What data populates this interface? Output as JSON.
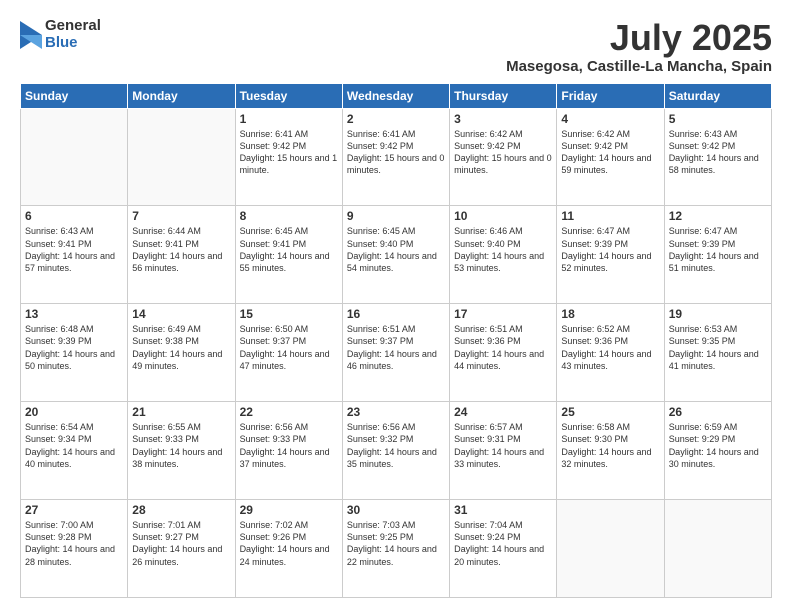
{
  "logo": {
    "general": "General",
    "blue": "Blue"
  },
  "title": "July 2025",
  "location": "Masegosa, Castille-La Mancha, Spain",
  "days_of_week": [
    "Sunday",
    "Monday",
    "Tuesday",
    "Wednesday",
    "Thursday",
    "Friday",
    "Saturday"
  ],
  "weeks": [
    [
      {
        "day": "",
        "info": ""
      },
      {
        "day": "",
        "info": ""
      },
      {
        "day": "1",
        "info": "Sunrise: 6:41 AM\nSunset: 9:42 PM\nDaylight: 15 hours and 1 minute."
      },
      {
        "day": "2",
        "info": "Sunrise: 6:41 AM\nSunset: 9:42 PM\nDaylight: 15 hours and 0 minutes."
      },
      {
        "day": "3",
        "info": "Sunrise: 6:42 AM\nSunset: 9:42 PM\nDaylight: 15 hours and 0 minutes."
      },
      {
        "day": "4",
        "info": "Sunrise: 6:42 AM\nSunset: 9:42 PM\nDaylight: 14 hours and 59 minutes."
      },
      {
        "day": "5",
        "info": "Sunrise: 6:43 AM\nSunset: 9:42 PM\nDaylight: 14 hours and 58 minutes."
      }
    ],
    [
      {
        "day": "6",
        "info": "Sunrise: 6:43 AM\nSunset: 9:41 PM\nDaylight: 14 hours and 57 minutes."
      },
      {
        "day": "7",
        "info": "Sunrise: 6:44 AM\nSunset: 9:41 PM\nDaylight: 14 hours and 56 minutes."
      },
      {
        "day": "8",
        "info": "Sunrise: 6:45 AM\nSunset: 9:41 PM\nDaylight: 14 hours and 55 minutes."
      },
      {
        "day": "9",
        "info": "Sunrise: 6:45 AM\nSunset: 9:40 PM\nDaylight: 14 hours and 54 minutes."
      },
      {
        "day": "10",
        "info": "Sunrise: 6:46 AM\nSunset: 9:40 PM\nDaylight: 14 hours and 53 minutes."
      },
      {
        "day": "11",
        "info": "Sunrise: 6:47 AM\nSunset: 9:39 PM\nDaylight: 14 hours and 52 minutes."
      },
      {
        "day": "12",
        "info": "Sunrise: 6:47 AM\nSunset: 9:39 PM\nDaylight: 14 hours and 51 minutes."
      }
    ],
    [
      {
        "day": "13",
        "info": "Sunrise: 6:48 AM\nSunset: 9:39 PM\nDaylight: 14 hours and 50 minutes."
      },
      {
        "day": "14",
        "info": "Sunrise: 6:49 AM\nSunset: 9:38 PM\nDaylight: 14 hours and 49 minutes."
      },
      {
        "day": "15",
        "info": "Sunrise: 6:50 AM\nSunset: 9:37 PM\nDaylight: 14 hours and 47 minutes."
      },
      {
        "day": "16",
        "info": "Sunrise: 6:51 AM\nSunset: 9:37 PM\nDaylight: 14 hours and 46 minutes."
      },
      {
        "day": "17",
        "info": "Sunrise: 6:51 AM\nSunset: 9:36 PM\nDaylight: 14 hours and 44 minutes."
      },
      {
        "day": "18",
        "info": "Sunrise: 6:52 AM\nSunset: 9:36 PM\nDaylight: 14 hours and 43 minutes."
      },
      {
        "day": "19",
        "info": "Sunrise: 6:53 AM\nSunset: 9:35 PM\nDaylight: 14 hours and 41 minutes."
      }
    ],
    [
      {
        "day": "20",
        "info": "Sunrise: 6:54 AM\nSunset: 9:34 PM\nDaylight: 14 hours and 40 minutes."
      },
      {
        "day": "21",
        "info": "Sunrise: 6:55 AM\nSunset: 9:33 PM\nDaylight: 14 hours and 38 minutes."
      },
      {
        "day": "22",
        "info": "Sunrise: 6:56 AM\nSunset: 9:33 PM\nDaylight: 14 hours and 37 minutes."
      },
      {
        "day": "23",
        "info": "Sunrise: 6:56 AM\nSunset: 9:32 PM\nDaylight: 14 hours and 35 minutes."
      },
      {
        "day": "24",
        "info": "Sunrise: 6:57 AM\nSunset: 9:31 PM\nDaylight: 14 hours and 33 minutes."
      },
      {
        "day": "25",
        "info": "Sunrise: 6:58 AM\nSunset: 9:30 PM\nDaylight: 14 hours and 32 minutes."
      },
      {
        "day": "26",
        "info": "Sunrise: 6:59 AM\nSunset: 9:29 PM\nDaylight: 14 hours and 30 minutes."
      }
    ],
    [
      {
        "day": "27",
        "info": "Sunrise: 7:00 AM\nSunset: 9:28 PM\nDaylight: 14 hours and 28 minutes."
      },
      {
        "day": "28",
        "info": "Sunrise: 7:01 AM\nSunset: 9:27 PM\nDaylight: 14 hours and 26 minutes."
      },
      {
        "day": "29",
        "info": "Sunrise: 7:02 AM\nSunset: 9:26 PM\nDaylight: 14 hours and 24 minutes."
      },
      {
        "day": "30",
        "info": "Sunrise: 7:03 AM\nSunset: 9:25 PM\nDaylight: 14 hours and 22 minutes."
      },
      {
        "day": "31",
        "info": "Sunrise: 7:04 AM\nSunset: 9:24 PM\nDaylight: 14 hours and 20 minutes."
      },
      {
        "day": "",
        "info": ""
      },
      {
        "day": "",
        "info": ""
      }
    ]
  ]
}
